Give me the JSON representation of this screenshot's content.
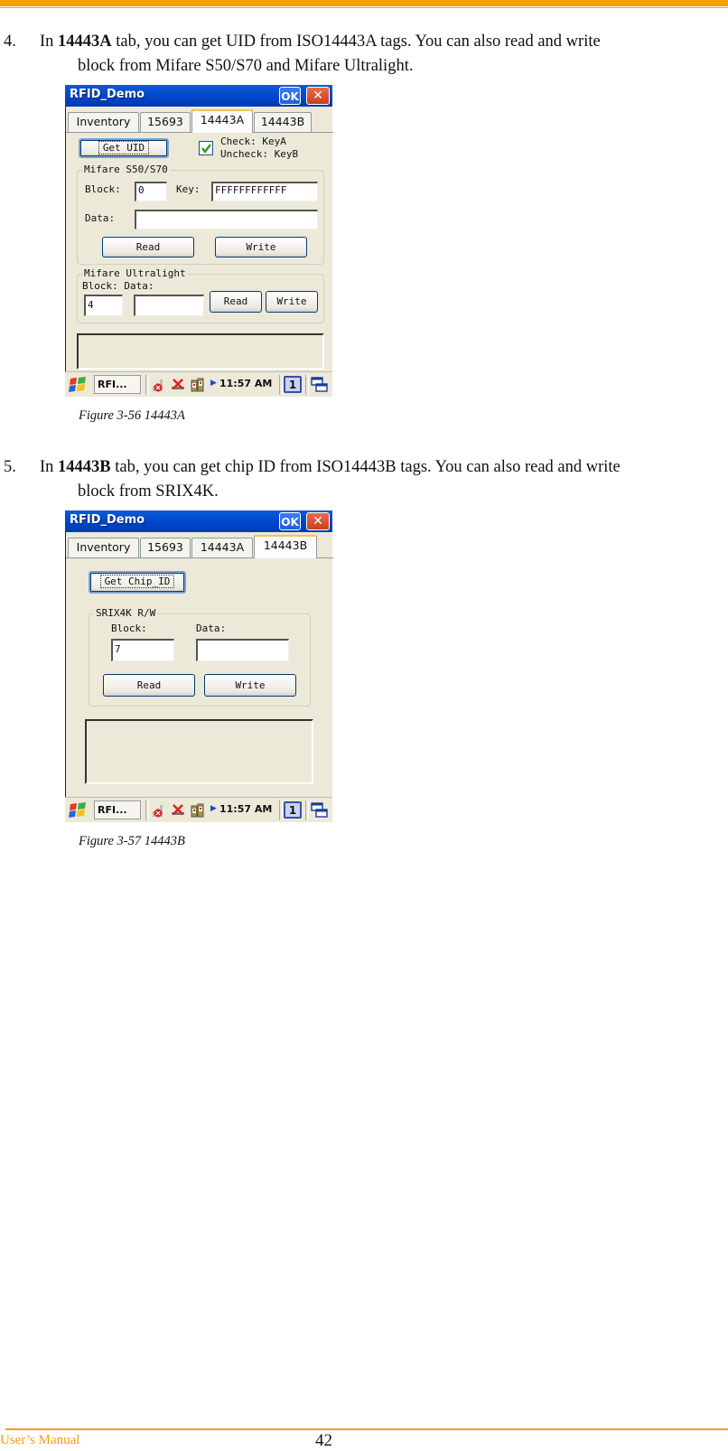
{
  "header": {
    "accent_color": "#f7a000"
  },
  "sections": [
    {
      "number": "4.",
      "intro": "In ",
      "bold": "14443A",
      "rest": " tab, you can get UID from ISO14443A tags. You can also read and write",
      "line2": "block from Mifare S50/S70 and Mifare Ultralight.",
      "caption": "Figure 3-56 14443A"
    },
    {
      "number": "5.",
      "intro": "In ",
      "bold": "14443B",
      "rest": " tab, you can get chip ID from ISO14443B tags. You can also read and write",
      "line2": "block from SRIX4K.",
      "caption": "Figure 3-57 14443B"
    }
  ],
  "screens": [
    {
      "title": "RFID_Demo",
      "ok_label": "OK",
      "close_label": "✕",
      "tabs": [
        "Inventory",
        "15693",
        "14443A",
        "14443B"
      ],
      "active_tab": "14443A",
      "get_uid_label": "Get UID",
      "check_text_1": "Check: KeyA",
      "check_text_2": "Uncheck: KeyB",
      "check_checked": true,
      "mifare_group": "Mifare S50/S70",
      "block_label": "Block:",
      "block_value": "0",
      "key_label": "Key:",
      "key_value": "FFFFFFFFFFFF",
      "data_label": "Data:",
      "data_value": "",
      "read_label": "Read",
      "write_label": "Write",
      "ultralight_group": "Mifare Ultralight",
      "ul_labels": "Block: Data:",
      "ul_block_value": "4",
      "ul_data_value": "",
      "ul_read_label": "Read",
      "ul_write_label": "Write",
      "output_text": ""
    },
    {
      "title": "RFID_Demo",
      "ok_label": "OK",
      "close_label": "✕",
      "tabs": [
        "Inventory",
        "15693",
        "14443A",
        "14443B"
      ],
      "active_tab": "14443B",
      "get_chip_label": "Get Chip_ID",
      "srix_group": "SRIX4K R/W",
      "block_label": "Block:",
      "block_value": "7",
      "data_label": "Data:",
      "data_value": "",
      "read_label": "Read",
      "write_label": "Write",
      "output_text": ""
    }
  ],
  "taskbar": {
    "app_label": "RFI...",
    "time": "11:57 AM",
    "desktop_number": "1",
    "icons": [
      "start-flag-icon",
      "signal-off-icon",
      "network-off-icon",
      "battery-icon",
      "tray-expand-icon",
      "window-switch-icon"
    ]
  },
  "footer": {
    "left_text": "User’s Manual",
    "page_number": "42",
    "accent_color": "#f39c12"
  }
}
